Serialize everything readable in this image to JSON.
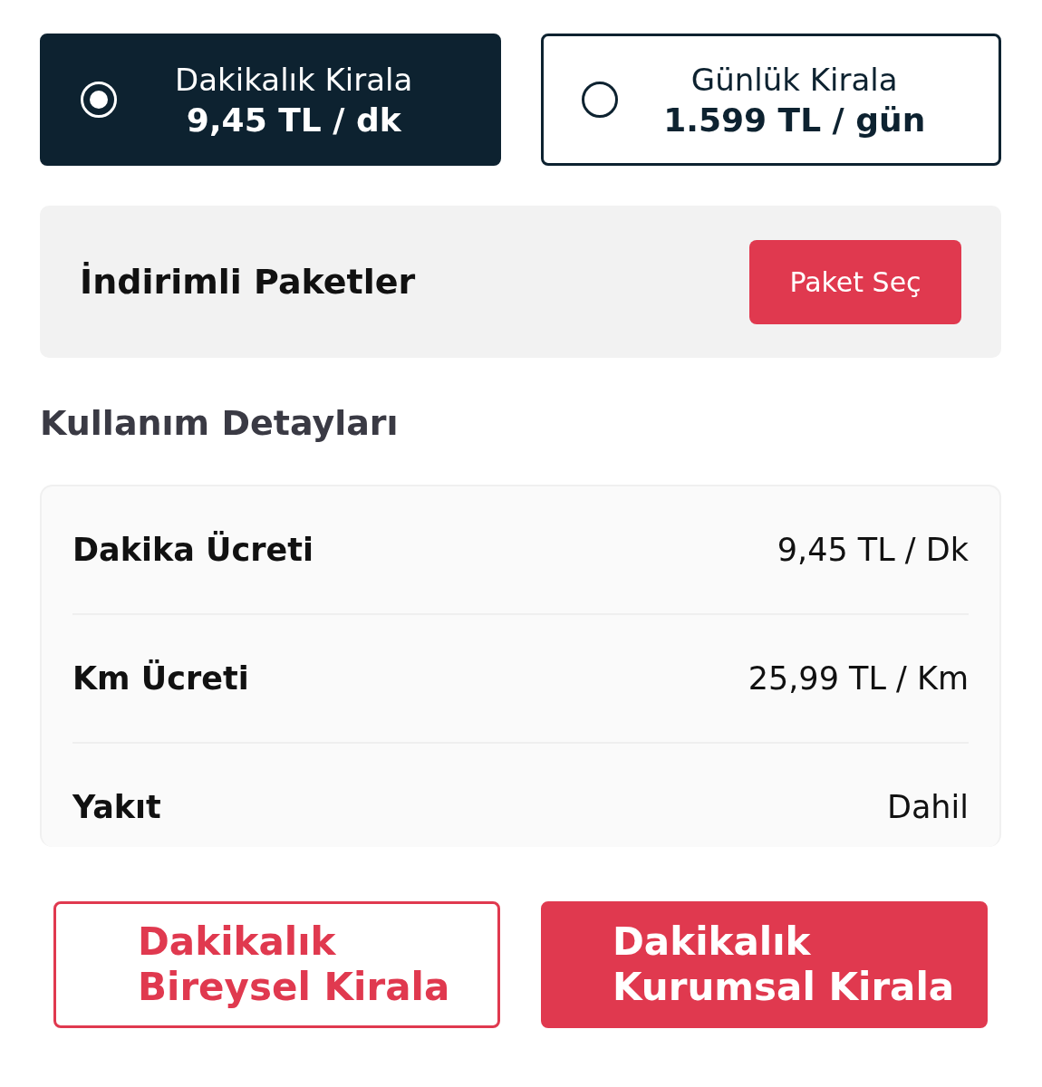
{
  "rental_options": [
    {
      "title": "Dakikalık Kirala",
      "price": "9,45 TL / dk",
      "selected": true
    },
    {
      "title": "Günlük Kirala",
      "price": "1.599 TL / gün",
      "selected": false
    }
  ],
  "packages": {
    "label": "İndirimli Paketler",
    "button": "Paket Seç"
  },
  "usage_details": {
    "heading": "Kullanım Detayları",
    "rows": [
      {
        "label": "Dakika Ücreti",
        "value": "9,45 TL / Dk"
      },
      {
        "label": "Km Ücreti",
        "value": "25,99 TL / Km"
      },
      {
        "label": "Yakıt",
        "value": "Dahil"
      }
    ]
  },
  "actions": [
    {
      "kind": "outline",
      "lines": [
        "Dakikalık",
        "Bireysel Kirala"
      ]
    },
    {
      "kind": "filled",
      "lines": [
        "Dakikalık",
        "Kurumsal Kirala"
      ]
    }
  ]
}
